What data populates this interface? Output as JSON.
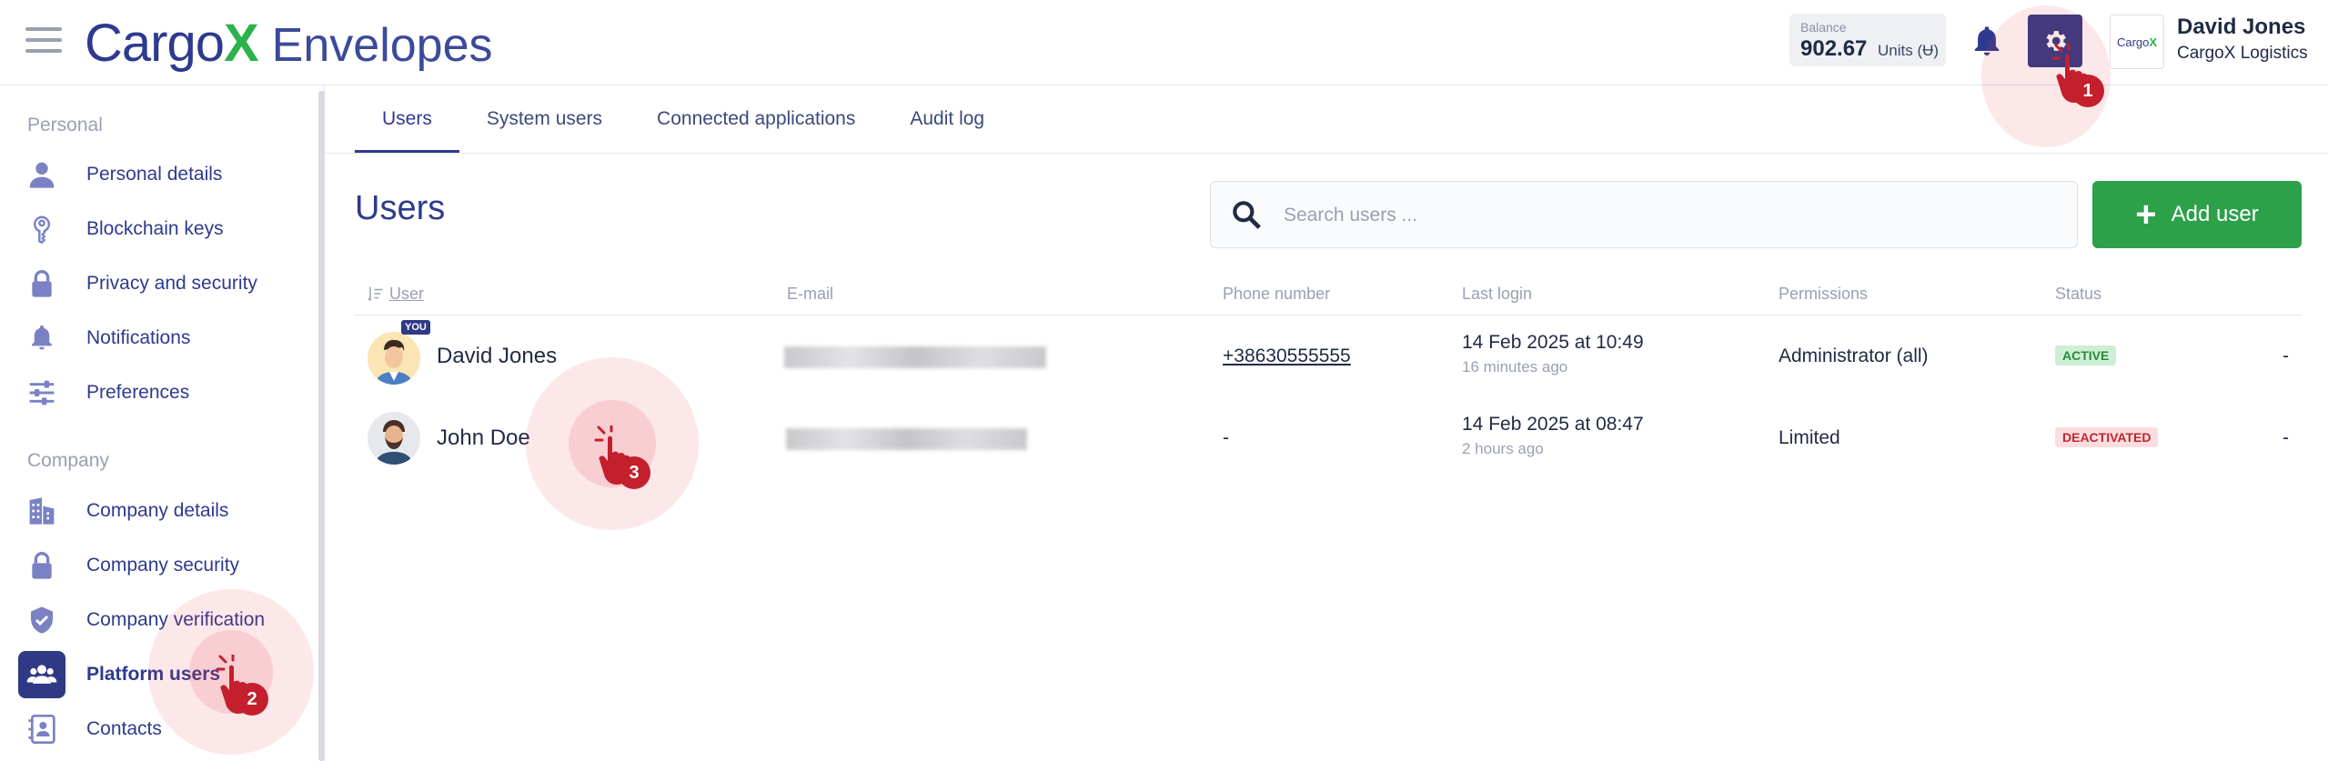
{
  "app": {
    "brand": "Cargo",
    "brand_x": "X",
    "product": "Envelopes"
  },
  "balance": {
    "label": "Balance",
    "value": "902.67",
    "unit": "Units (Ʉ)"
  },
  "user": {
    "name": "David Jones",
    "company": "CargoX Logistics",
    "company_logo_text": "Cargo",
    "company_logo_x": "X"
  },
  "sidebar": {
    "personal_title": "Personal",
    "personal": [
      {
        "label": "Personal details",
        "icon": "person-icon"
      },
      {
        "label": "Blockchain keys",
        "icon": "key-icon"
      },
      {
        "label": "Privacy and security",
        "icon": "lock-icon"
      },
      {
        "label": "Notifications",
        "icon": "bell-icon"
      },
      {
        "label": "Preferences",
        "icon": "sliders-icon"
      }
    ],
    "company_title": "Company",
    "company": [
      {
        "label": "Company details",
        "icon": "building-icon"
      },
      {
        "label": "Company security",
        "icon": "lock-icon"
      },
      {
        "label": "Company verification",
        "icon": "shield-check-icon"
      },
      {
        "label": "Platform users",
        "icon": "users-icon",
        "active": true
      },
      {
        "label": "Contacts",
        "icon": "contacts-icon"
      }
    ]
  },
  "tabs": [
    "Users",
    "System users",
    "Connected applications",
    "Audit log"
  ],
  "page": {
    "title": "Users"
  },
  "search": {
    "placeholder": "Search users ..."
  },
  "add_button": {
    "label": "Add user"
  },
  "table": {
    "headers": [
      "User",
      "E-mail",
      "Phone number",
      "Last login",
      "Permissions",
      "Status"
    ],
    "rows": [
      {
        "name": "David Jones",
        "you_badge": "YOU",
        "phone": "+38630555555",
        "last_login": "14 Feb 2025 at 10:49",
        "last_login_ago": "16 minutes ago",
        "permissions": "Administrator (all)",
        "status": "ACTIVE",
        "action": "-"
      },
      {
        "name": "John Doe",
        "phone": "-",
        "last_login": "14 Feb 2025 at 08:47",
        "last_login_ago": "2 hours ago",
        "permissions": "Limited",
        "status": "DEACTIVATED",
        "action": "-"
      }
    ]
  },
  "markers": [
    "1",
    "2",
    "3"
  ],
  "colors": {
    "primary": "#2e3a8f",
    "accent_green": "#2db14a",
    "add_button": "#2da04a",
    "marker_red": "#c41f2d"
  }
}
